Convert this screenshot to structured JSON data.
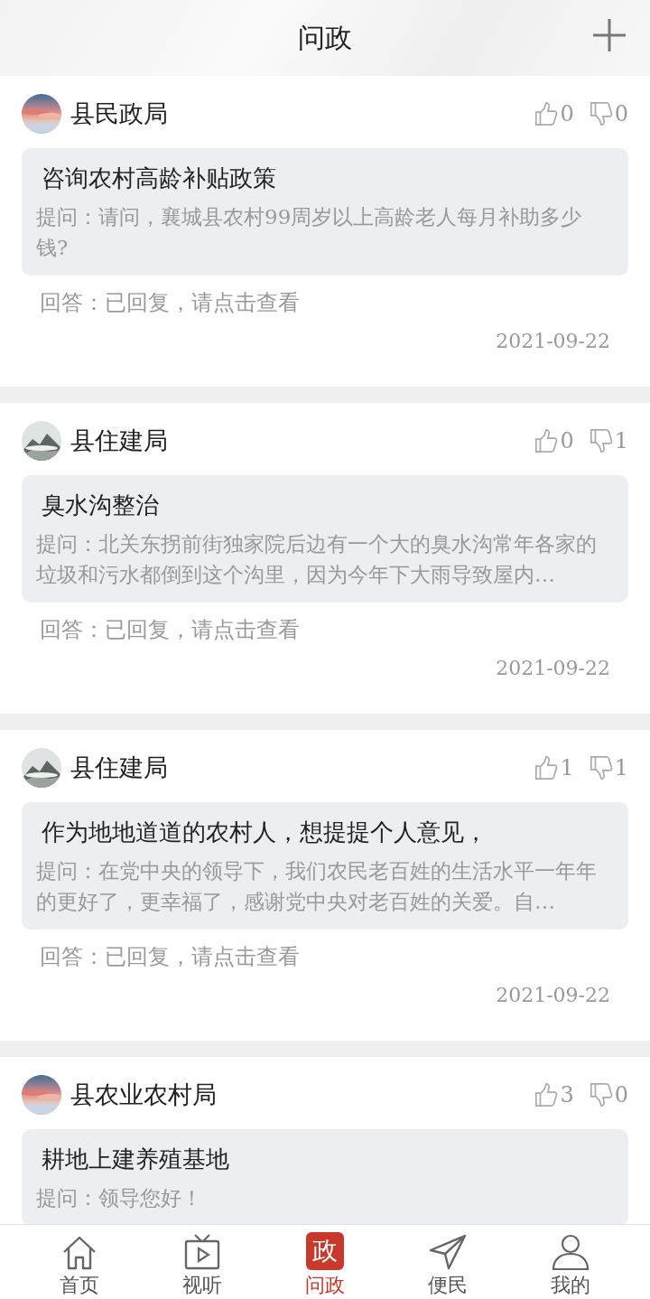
{
  "header": {
    "title": "问政"
  },
  "posts": [
    {
      "department": "县民政局",
      "kind": "sunset",
      "likes": "0",
      "dislikes": "0",
      "title": "咨询农村高龄补贴政策",
      "question": "提问：请问，襄城县农村99周岁以上高龄老人每月补助多少钱?",
      "answer": "回答：已回复，请点击查看",
      "date": "2021-09-22"
    },
    {
      "department": "县住建局",
      "kind": "mountain",
      "likes": "0",
      "dislikes": "1",
      "title": "臭水沟整治",
      "question": "提问：北关东拐前街独家院后边有一个大的臭水沟常年各家的垃圾和污水都倒到这个沟里，因为今年下大雨导致屋内…",
      "answer": "回答：已回复，请点击查看",
      "date": "2021-09-22"
    },
    {
      "department": "县住建局",
      "kind": "mountain",
      "likes": "1",
      "dislikes": "1",
      "title": "作为地地道道的农村人，想提提个人意见，",
      "question": "提问：在党中央的领导下，我们农民老百姓的生活水平一年年的更好了，更幸福了，感谢党中央对老百姓的关爱。自…",
      "answer": "回答：已回复，请点击查看",
      "date": "2021-09-22"
    },
    {
      "department": "县农业农村局",
      "kind": "sunset",
      "likes": "3",
      "dislikes": "0",
      "title": "耕地上建养殖基地",
      "question": "提问：领导您好！"
    }
  ],
  "nav": [
    {
      "label": "首页",
      "kind": "home",
      "selected": false
    },
    {
      "label": "视听",
      "kind": "tv",
      "selected": false
    },
    {
      "label": "问政",
      "kind": "badge",
      "badge": "政",
      "selected": true
    },
    {
      "label": "便民",
      "kind": "send",
      "selected": false
    },
    {
      "label": "我的",
      "kind": "person",
      "selected": false
    }
  ]
}
